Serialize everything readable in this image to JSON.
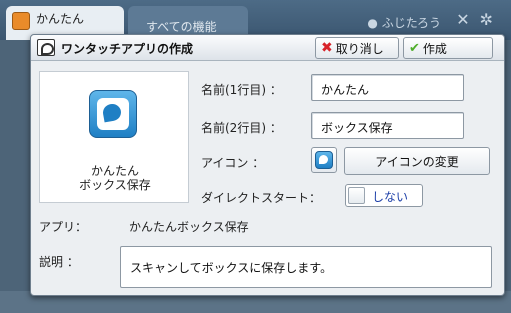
{
  "background": {
    "tabs": [
      {
        "label": "かんたん"
      },
      {
        "label": "すべての機能"
      }
    ],
    "user_name": "ふじたろう"
  },
  "dialog": {
    "title": "ワンタッチアプリの作成",
    "cancel_label": "取り消し",
    "create_label": "作成",
    "preview": {
      "line1": "かんたん",
      "line2": "ボックス保存"
    },
    "fields": {
      "name1_label": "名前(1行目) ：",
      "name1_value": "かんたん",
      "name2_label": "名前(2行目) ：",
      "name2_value": "ボックス保存",
      "icon_label": "アイコン ：",
      "change_icon_label": "アイコンの変更",
      "direct_start_label": "ダイレクトスタート：",
      "direct_start_value": "しない",
      "app_label": "アプリ：",
      "app_value": "かんたんボックス保存",
      "description_label": "説明 ：",
      "description_value": "スキャンしてボックスに保存します。"
    }
  },
  "colors": {
    "accent_blue": "#1f7fc4",
    "cancel_red": "#d8232a",
    "create_green": "#4fae2a"
  }
}
